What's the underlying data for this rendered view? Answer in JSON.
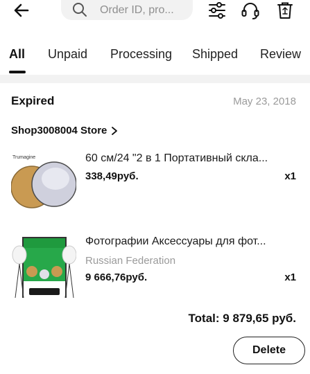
{
  "header": {
    "search_placeholder": "Order ID, pro...",
    "icons": [
      "back-arrow-icon",
      "search-icon",
      "filter-icon",
      "headset-icon",
      "trash-icon"
    ]
  },
  "tabs": [
    {
      "label": "All",
      "active": true
    },
    {
      "label": "Unpaid",
      "active": false
    },
    {
      "label": "Processing",
      "active": false
    },
    {
      "label": "Shipped",
      "active": false
    },
    {
      "label": "Review",
      "active": false
    }
  ],
  "order": {
    "status": "Expired",
    "date": "May 23, 2018",
    "store": "Shop3008004 Store",
    "products": [
      {
        "title": "60 см/24 \"2 в 1 Портативный скла...",
        "variant": "",
        "price": "338,49руб.",
        "qty": "x1",
        "thumb_brand": "Trumagine"
      },
      {
        "title": "Фотографии Аксессуары для фот...",
        "variant": "Russian Federation",
        "price": "9 666,76руб.",
        "qty": "x1"
      }
    ],
    "total": "Total: 9 879,65 руб.",
    "delete_label": "Delete"
  },
  "colors": {
    "accent": "#111111",
    "muted": "#9a9a9a",
    "separator": "#f2f2f2"
  }
}
